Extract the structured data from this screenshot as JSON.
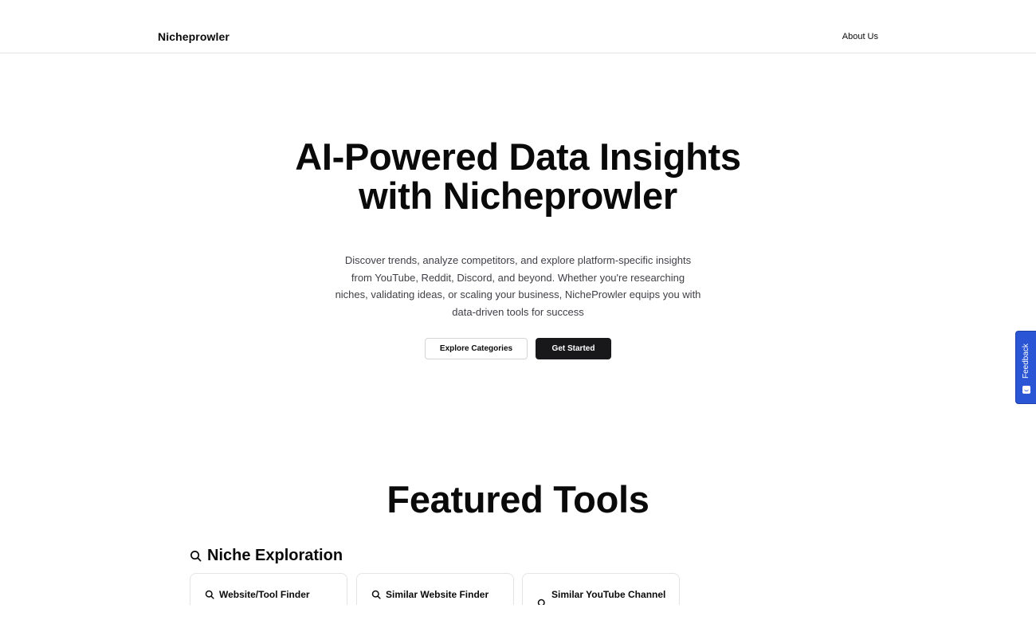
{
  "header": {
    "brand": "Nicheprowler",
    "nav_about": "About Us"
  },
  "hero": {
    "title_line1": "AI-Powered Data Insights",
    "title_line2": "with Nicheprowler",
    "description": "Discover trends, analyze competitors, and explore platform-specific insights from YouTube, Reddit, Discord, and beyond. Whether you're researching niches, validating ideas, or scaling your business, NicheProwler equips you with data-driven tools for success",
    "btn_explore": "Explore Categories",
    "btn_start": "Get Started"
  },
  "feedback": {
    "label": "Feedback"
  },
  "featured": {
    "title": "Featured Tools",
    "section_title": "Niche Exploration",
    "cards": [
      {
        "title": "Website/Tool Finder"
      },
      {
        "title": "Similar Website Finder"
      },
      {
        "title": "Similar YouTube Channel"
      }
    ]
  },
  "colors": {
    "primary_dark": "#18181b",
    "feedback_blue": "#2a55d4",
    "border": "#e4e4e7",
    "muted_text": "#3f3f46"
  },
  "icons": {
    "search": "search-icon",
    "feedback": "feedback-icon"
  }
}
